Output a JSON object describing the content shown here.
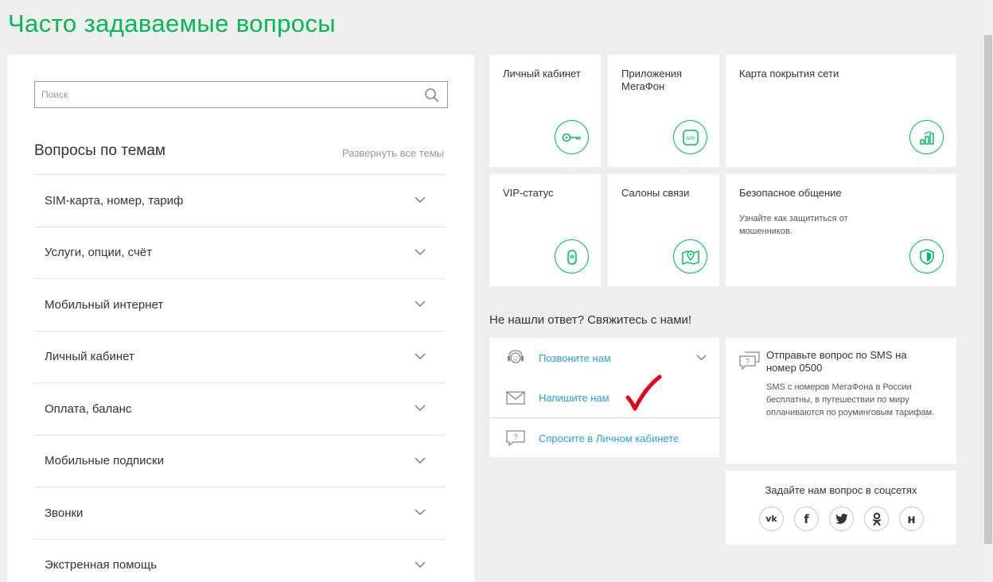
{
  "page": {
    "title": "Часто задаваемые вопросы"
  },
  "search": {
    "placeholder": "Поиск",
    "value": ""
  },
  "topics": {
    "title": "Вопросы по темам",
    "expand_all": "Развернуть все темы",
    "items": [
      {
        "label": "SIM-карта, номер, тариф"
      },
      {
        "label": "Услуги, опции, счёт"
      },
      {
        "label": "Мобильный интернет"
      },
      {
        "label": "Личный кабинет"
      },
      {
        "label": "Оплата, баланс"
      },
      {
        "label": "Мобильные подписки"
      },
      {
        "label": "Звонки"
      },
      {
        "label": "Экстренная помощь"
      }
    ]
  },
  "tiles": [
    {
      "label": "Личный кабинет",
      "icon": "key-icon"
    },
    {
      "label": "Приложения МегаФон",
      "icon": "app-icon",
      "icon_text": "APP"
    },
    {
      "label": "Карта покрытия сети",
      "icon": "signal-icon"
    },
    {
      "label": "VIP-статус",
      "icon": "vip-icon"
    },
    {
      "label": "Салоны связи",
      "icon": "map-pin-icon"
    },
    {
      "label": "Безопасное общение",
      "subtitle": "Узнайте как защититься от мошенников.",
      "icon": "shield-icon"
    }
  ],
  "contact": {
    "heading": "Не нашли ответ? Свяжитесь с нами!",
    "items": [
      {
        "label": "Позвоните нам",
        "icon": "headset-icon"
      },
      {
        "label": "Напишите нам",
        "icon": "envelope-icon"
      },
      {
        "label": "Спросите в Личном кабинете",
        "icon": "question-chat-icon"
      }
    ]
  },
  "sms": {
    "title": "Отправьте вопрос по SMS на номер 0500",
    "text": "SMS с номеров МегаФона в России бесплатны, в путешествии по миру оплачиваются по роуминговым тарифам."
  },
  "social": {
    "title": "Задайте нам вопрос в соцсетях",
    "items": [
      {
        "label": "vk",
        "text": "vk"
      },
      {
        "label": "facebook",
        "text": "f"
      },
      {
        "label": "twitter",
        "text": "t"
      },
      {
        "label": "odnoklassniki",
        "text": "ok"
      },
      {
        "label": "hh",
        "text": "н"
      }
    ]
  },
  "colors": {
    "accent": "#00b956",
    "link": "#2a9fd8",
    "checkmark": "#e0001b"
  }
}
